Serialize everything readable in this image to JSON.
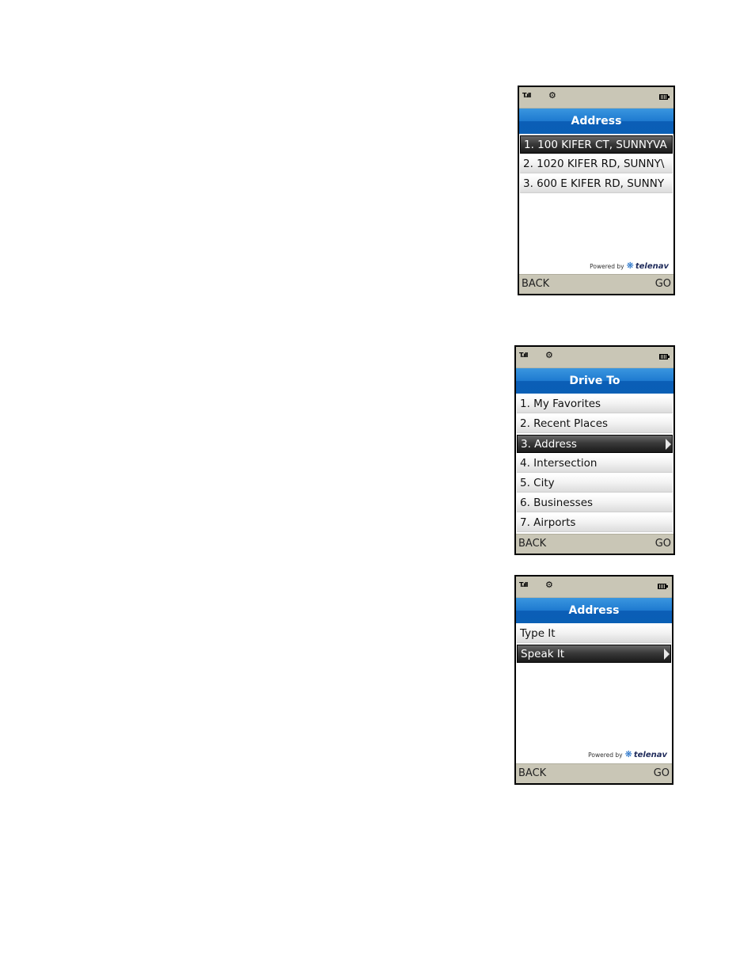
{
  "screens": [
    {
      "title": "Address",
      "items": [
        "1.  100 KIFER CT, SUNNYVA",
        "2.  1020 KIFER RD, SUNNY\\",
        "3.  600 E KIFER RD, SUNNY"
      ],
      "powered_by": "Powered by",
      "brand": "telenav",
      "back": "BACK",
      "go": "GO"
    },
    {
      "title": "Drive To",
      "items": [
        "1. My Favorites",
        "2. Recent Places",
        "3. Address",
        "4. Intersection",
        "5. City",
        "6. Businesses",
        "7. Airports"
      ],
      "back": "BACK",
      "go": "GO"
    },
    {
      "title": "Address",
      "items": [
        "Type It",
        "Speak It"
      ],
      "powered_by": "Powered by",
      "brand": "telenav",
      "back": "BACK",
      "go": "GO"
    }
  ],
  "icons": [
    "signal-icon",
    "gear-icon",
    "battery-icon",
    "telenav-logo-icon",
    "chevron-right-icon"
  ],
  "colors": {
    "title_bar": "#1e7ad0",
    "status_bar": "#c9c6b6",
    "selected_row": "#2a2a2a"
  }
}
